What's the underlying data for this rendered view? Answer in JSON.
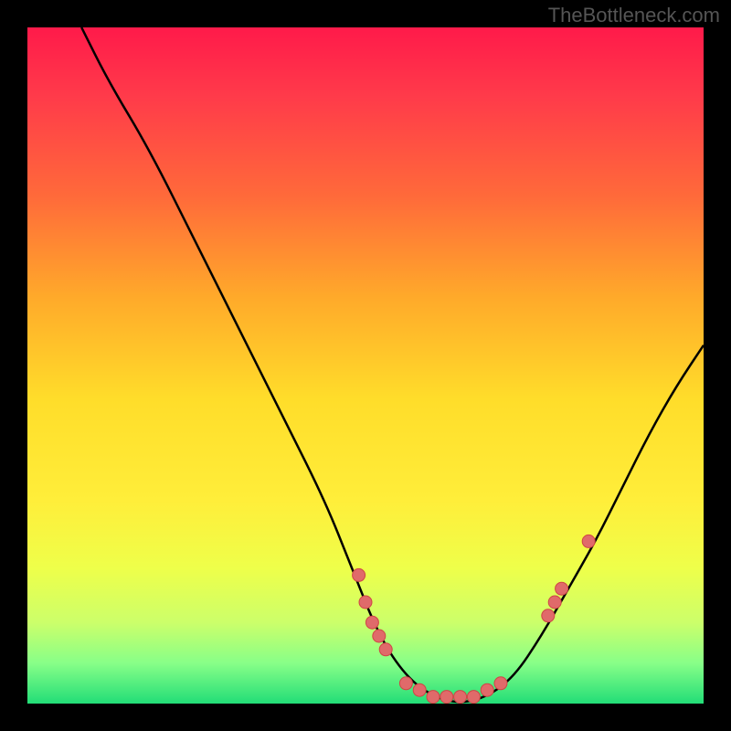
{
  "attribution": "TheBottleneck.com",
  "chart_data": {
    "type": "line",
    "title": "",
    "xlabel": "",
    "ylabel": "",
    "xlim": [
      0,
      100
    ],
    "ylim": [
      0,
      100
    ],
    "curve": [
      {
        "x": 8,
        "y": 100
      },
      {
        "x": 12,
        "y": 92
      },
      {
        "x": 18,
        "y": 82
      },
      {
        "x": 25,
        "y": 68
      },
      {
        "x": 32,
        "y": 54
      },
      {
        "x": 38,
        "y": 42
      },
      {
        "x": 44,
        "y": 30
      },
      {
        "x": 48,
        "y": 20
      },
      {
        "x": 52,
        "y": 10
      },
      {
        "x": 56,
        "y": 4
      },
      {
        "x": 60,
        "y": 1
      },
      {
        "x": 64,
        "y": 0
      },
      {
        "x": 68,
        "y": 1
      },
      {
        "x": 72,
        "y": 4
      },
      {
        "x": 76,
        "y": 10
      },
      {
        "x": 80,
        "y": 17
      },
      {
        "x": 84,
        "y": 24
      },
      {
        "x": 88,
        "y": 32
      },
      {
        "x": 92,
        "y": 40
      },
      {
        "x": 96,
        "y": 47
      },
      {
        "x": 100,
        "y": 53
      }
    ],
    "dots": [
      {
        "x": 49,
        "y": 19
      },
      {
        "x": 50,
        "y": 15
      },
      {
        "x": 51,
        "y": 12
      },
      {
        "x": 52,
        "y": 10
      },
      {
        "x": 53,
        "y": 8
      },
      {
        "x": 56,
        "y": 3
      },
      {
        "x": 58,
        "y": 2
      },
      {
        "x": 60,
        "y": 1
      },
      {
        "x": 62,
        "y": 1
      },
      {
        "x": 64,
        "y": 1
      },
      {
        "x": 66,
        "y": 1
      },
      {
        "x": 68,
        "y": 2
      },
      {
        "x": 70,
        "y": 3
      },
      {
        "x": 77,
        "y": 13
      },
      {
        "x": 78,
        "y": 15
      },
      {
        "x": 79,
        "y": 17
      },
      {
        "x": 83,
        "y": 24
      }
    ],
    "background_gradient": {
      "top": "#ff1a4a",
      "mid": "#ffdd2a",
      "bottom": "#22dd77"
    }
  }
}
